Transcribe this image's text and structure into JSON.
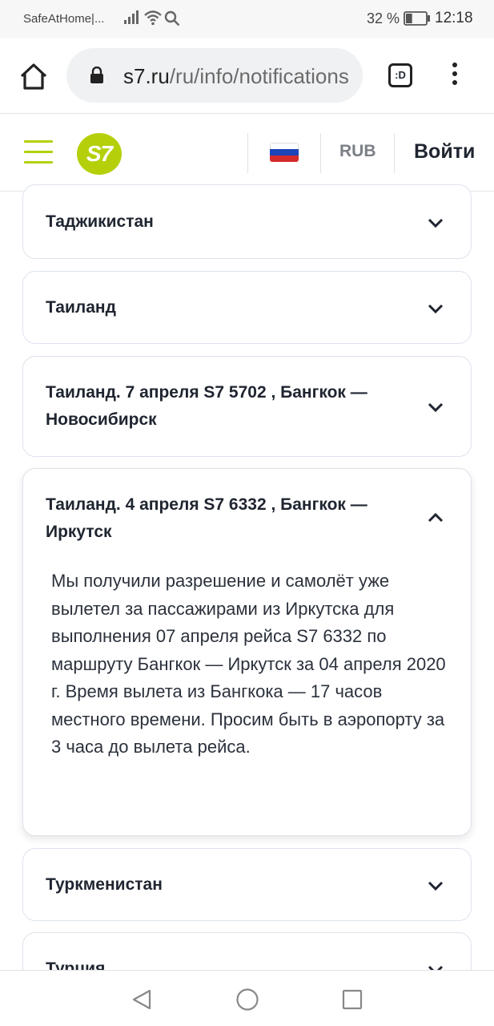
{
  "status_bar": {
    "app_name": "SafeAtHome|...",
    "battery_percent": "32 %",
    "time": "12:18",
    "battery_level": 0.32
  },
  "browser": {
    "url_domain": "s7.ru",
    "url_path": "/ru/info/notifications",
    "tabs_label": ":D"
  },
  "site_header": {
    "logo_text": "S7",
    "currency": "RUB",
    "login": "Войти",
    "brand_color": "#b5d00a"
  },
  "accordion": {
    "items": [
      {
        "title": "Таджикистан",
        "open": false
      },
      {
        "title": "Таиланд",
        "open": false
      },
      {
        "title": "Таиланд. 7 апреля S7 5702 , Бангкок — Новосибирск",
        "open": false
      },
      {
        "title": "Таиланд. 4 апреля S7 6332 , Бангкок — Иркутск",
        "open": true,
        "body": "Мы получили разрешение и самолёт уже вылетел за пассажирами из Иркутска для выполнения 07 апреля рейса S7 6332 по маршруту Бангкок — Иркутск за 04 апреля 2020 г. Время вылета из Бангкока — 17 часов местного времени. Просим быть в аэропорту за 3 часа до вылета рейса."
      },
      {
        "title": "Туркменистан",
        "open": false
      },
      {
        "title": "Турция",
        "open": false
      }
    ]
  }
}
